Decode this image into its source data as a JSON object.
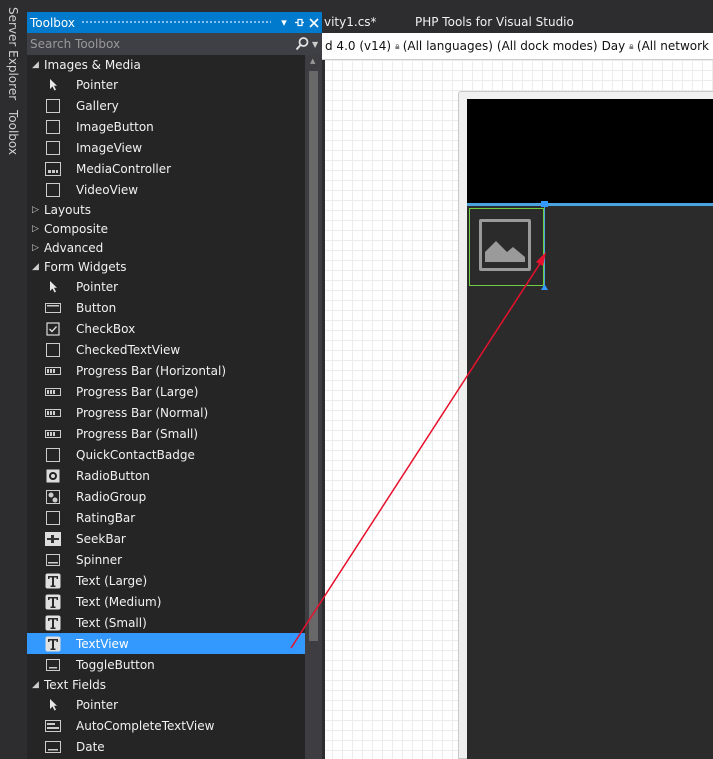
{
  "side_tabs": {
    "server_explorer": "Server Explorer",
    "toolbox": "Toolbox"
  },
  "toolbox": {
    "title": "Toolbox",
    "search_placeholder": "Search Toolbox",
    "groups": [
      {
        "label": "Images & Media",
        "expanded": true,
        "items": [
          {
            "label": "Pointer",
            "icon": "pointer-icon"
          },
          {
            "label": "Gallery",
            "icon": "gallery-icon"
          },
          {
            "label": "ImageButton",
            "icon": "imagebutton-icon"
          },
          {
            "label": "ImageView",
            "icon": "imageview-icon"
          },
          {
            "label": "MediaController",
            "icon": "mediacontroller-icon"
          },
          {
            "label": "VideoView",
            "icon": "videoview-icon"
          }
        ]
      },
      {
        "label": "Layouts",
        "expanded": false,
        "items": []
      },
      {
        "label": "Composite",
        "expanded": false,
        "items": []
      },
      {
        "label": "Advanced",
        "expanded": false,
        "items": []
      },
      {
        "label": "Form Widgets",
        "expanded": true,
        "items": [
          {
            "label": "Pointer",
            "icon": "pointer-icon"
          },
          {
            "label": "Button",
            "icon": "button-icon"
          },
          {
            "label": "CheckBox",
            "icon": "checkbox-icon"
          },
          {
            "label": "CheckedTextView",
            "icon": "checkedtextview-icon"
          },
          {
            "label": "Progress Bar (Horizontal)",
            "icon": "progressbar-icon"
          },
          {
            "label": "Progress Bar (Large)",
            "icon": "progressbar-icon"
          },
          {
            "label": "Progress Bar (Normal)",
            "icon": "progressbar-icon"
          },
          {
            "label": "Progress Bar (Small)",
            "icon": "progressbar-icon"
          },
          {
            "label": "QuickContactBadge",
            "icon": "quickcontactbadge-icon"
          },
          {
            "label": "RadioButton",
            "icon": "radiobutton-icon"
          },
          {
            "label": "RadioGroup",
            "icon": "radiogroup-icon"
          },
          {
            "label": "RatingBar",
            "icon": "ratingbar-icon"
          },
          {
            "label": "SeekBar",
            "icon": "seekbar-icon"
          },
          {
            "label": "Spinner",
            "icon": "spinner-icon"
          },
          {
            "label": "Text (Large)",
            "icon": "text-icon"
          },
          {
            "label": "Text (Medium)",
            "icon": "text-icon"
          },
          {
            "label": "Text (Small)",
            "icon": "text-icon"
          },
          {
            "label": "TextView",
            "icon": "text-icon",
            "selected": true
          },
          {
            "label": "ToggleButton",
            "icon": "togglebutton-icon"
          }
        ]
      },
      {
        "label": "Text Fields",
        "expanded": true,
        "items": [
          {
            "label": "Pointer",
            "icon": "pointer-icon"
          },
          {
            "label": "AutoCompleteTextView",
            "icon": "autocomplete-icon"
          },
          {
            "label": "Date",
            "icon": "date-icon"
          }
        ]
      }
    ]
  },
  "tabs": {
    "file": "vity1.cs*",
    "php": "PHP Tools for Visual Studio"
  },
  "designer_toolbar": {
    "api": "d 4.0 (v14)",
    "languages": "(All languages)",
    "dock": "(All dock modes)",
    "day": "Day",
    "network": "(All network"
  },
  "colors": {
    "accent": "#007acc",
    "selection": "#3399ff",
    "arrow": "#e8112d",
    "imageview_border": "#6fcf3f"
  }
}
